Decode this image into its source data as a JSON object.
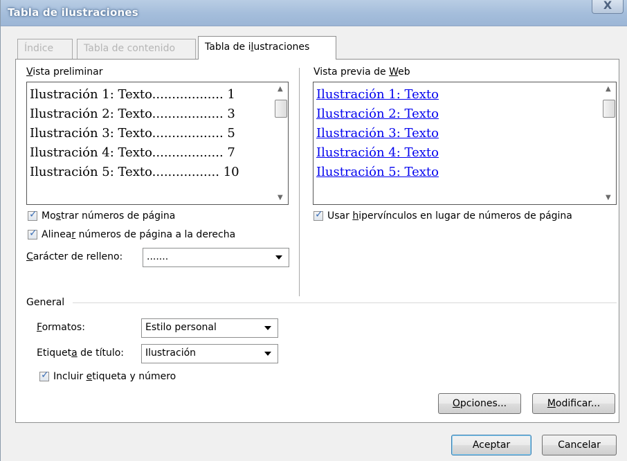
{
  "window": {
    "title": "Tabla de ilustraciones",
    "close_label": "X"
  },
  "tabs": [
    {
      "label": "Índice",
      "active": false,
      "enabled": false
    },
    {
      "label": "Tabla de contenido",
      "active": false,
      "enabled": false
    },
    {
      "label_pre": "Tabla de i",
      "label_u": "l",
      "label_post": "ustraciones",
      "active": true,
      "enabled": true
    }
  ],
  "print_preview": {
    "label_u": "V",
    "label_post": "ista preliminar",
    "lines": [
      {
        "text": "Ilustración 1: Texto",
        "leader": "..................",
        "page": "1"
      },
      {
        "text": "Ilustración 2: Texto",
        "leader": "..................",
        "page": "3"
      },
      {
        "text": "Ilustración 3: Texto",
        "leader": "..................",
        "page": "5"
      },
      {
        "text": "Ilustración 4: Texto",
        "leader": "..................",
        "page": "7"
      },
      {
        "text": "Ilustración 5: Texto",
        "leader": ".................",
        "page": "10"
      }
    ]
  },
  "web_preview": {
    "label_pre": "Vista previa de ",
    "label_u": "W",
    "label_post": "eb",
    "lines": [
      "Ilustración 1: Texto",
      "Ilustración 2: Texto",
      "Ilustración 3: Texto",
      "Ilustración 4: Texto",
      "Ilustración 5: Texto"
    ]
  },
  "options": {
    "show_page_numbers": {
      "pre": "Mo",
      "u": "s",
      "post": "trar números de página",
      "checked": true
    },
    "right_align": {
      "pre": "Alinea",
      "u": "r",
      "post": " números de página a la derecha",
      "checked": true
    },
    "fill_char": {
      "label_u": "C",
      "label_post": "arácter de relleno:",
      "value": "......."
    },
    "use_hyperlinks": {
      "pre": "Usar ",
      "u": "h",
      "post": "ipervínculos en lugar de números de página",
      "checked": true
    }
  },
  "general": {
    "heading": "General",
    "formats": {
      "label_u": "F",
      "label_post": "ormatos:",
      "value": "Estilo personal"
    },
    "caption": {
      "label_pre": "Etiquet",
      "label_u": "a",
      "label_post": " de título:",
      "value": "Ilustración"
    },
    "include_label": {
      "pre": "Incluir ",
      "u": "e",
      "post": "tiqueta y número",
      "checked": true
    }
  },
  "buttons": {
    "options": {
      "u": "O",
      "post": "pciones..."
    },
    "modify": {
      "u": "M",
      "post": "odificar..."
    },
    "ok": "Aceptar",
    "cancel": "Cancelar"
  }
}
